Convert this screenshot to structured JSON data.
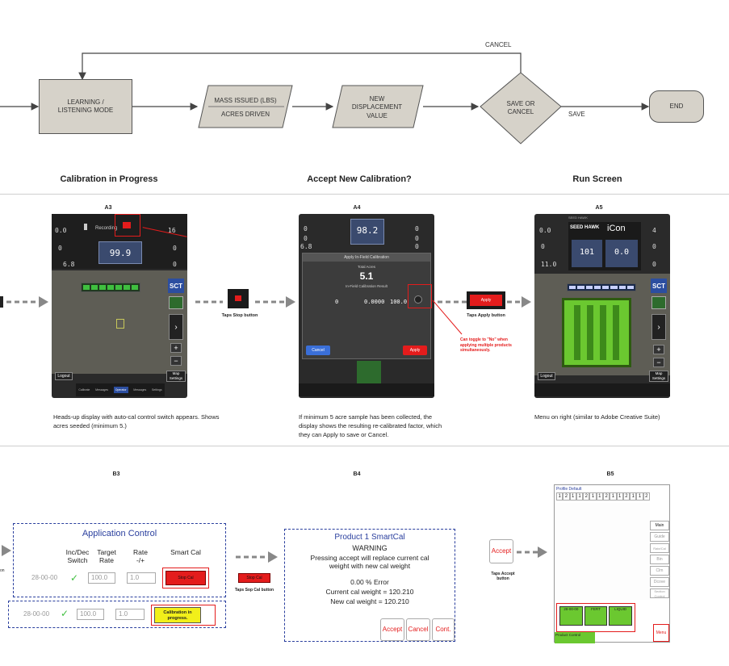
{
  "flow": {
    "cancel_label": "CANCEL",
    "save_label": "SAVE",
    "learning_label": "LEARNING / LISTENING MODE",
    "mass_label": "MASS ISSUED (LBS)",
    "acres_label": "ACRES DRIVEN",
    "new_disp_label": "NEW DISPLACEMENT VALUE",
    "save_cancel_label": "SAVE OR CANCEL",
    "end_label": "END"
  },
  "sections": {
    "calibration": "Calibration in Progress",
    "accept": "Accept New Calibration?",
    "run": "Run Screen"
  },
  "screen_a3": {
    "label": "A3",
    "caption": "Heads-up display with auto-cal control switch appears. Shows acres seeded (minimum 5.)",
    "recording": "Recording",
    "big_value": "99.9",
    "val_left_1": "0.0",
    "val_left_2": "0",
    "val_left_3": "6.8",
    "val_right_1": "16",
    "val_right_2": "0",
    "val_right_3": "0",
    "sct": "SCT",
    "logout": "Logout",
    "map_settings": "Map Settings",
    "nav": [
      "Calibrate",
      "Messages",
      "Operator",
      "Messages",
      "Settings"
    ]
  },
  "arrow_a3_a4": {
    "caption": "Taps Stop button"
  },
  "screen_a4": {
    "label": "A4",
    "caption": "If minimum 5 acre sample has been collected, the display shows the resulting re-calibrated factor, which they can Apply to save or Cancel.",
    "big_value": "98.2",
    "val_left_1": "0",
    "val_left_2": "0",
    "val_left_3": "6.8",
    "val_right_1": "0",
    "val_right_2": "0",
    "val_right_3": "0",
    "dialog_title": "Apply In-Field Calibration",
    "total_acres_label": "Total Acres",
    "total_acres": "5.1",
    "result_label": "In-Field Calibration Result",
    "row_values": [
      "0",
      "0.0000",
      "100.0"
    ],
    "cancel_btn": "Cancel",
    "apply_btn": "Apply",
    "toggle_note": "Can toggle to \"No\" when applying multiple products simultaneously."
  },
  "arrow_a4_a5": {
    "button": "Apply",
    "caption": "Taps Apply button"
  },
  "screen_a5": {
    "label": "A5",
    "caption": "Menu on right (similar to Adobe Creative Suite)",
    "brand": "SEED HAWK",
    "icon_brand": "iCon",
    "val_left_1": "0.0",
    "val_left_2": "0",
    "val_left_3": "11.0",
    "val_right_1": "4",
    "val_right_2": "0",
    "val_right_3": "0",
    "value_1": "101",
    "value_2": "0.0",
    "sct": "SCT",
    "logout": "Logout",
    "map_settings": "Map Settings"
  },
  "screen_b3": {
    "label": "B3",
    "title": "Application Control",
    "col_headers": [
      "Inc/Dec Switch",
      "Target Rate",
      "Rate -/+",
      "Smart Cal"
    ],
    "row1": {
      "product": "28-00-00",
      "target": "100.0",
      "rate": "1.0",
      "button": "Stop Cal"
    },
    "row2": {
      "product": "28-00-00",
      "target": "100.0",
      "rate": "1.0",
      "button": "Calibration in progress."
    },
    "side_text": "on"
  },
  "arrow_b3_b4": {
    "button": "Stop Cal",
    "caption": "Taps Sop Cal button"
  },
  "screen_b4": {
    "label": "B4",
    "title": "Product 1 SmartCal",
    "warning": "WARNING",
    "message": "Pressing accept will replace current cal weight with new cal weight",
    "error": "0.00 % Error",
    "current": "Current cal weight = 120.210",
    "new": "New cal weight = 120.210",
    "buttons": [
      "Accept",
      "Cancel",
      "Cont."
    ]
  },
  "arrow_b4_b5": {
    "button": "Accept",
    "caption": "Taps Accept button"
  },
  "screen_b5": {
    "label": "B5",
    "profile": "Profile Default",
    "sections": [
      "1",
      "2",
      "1",
      "1",
      "2",
      "1",
      "1",
      "2",
      "1",
      "1",
      "2",
      "1",
      "1",
      "2",
      "1",
      "1"
    ],
    "menu_items": [
      "Main",
      "Guide",
      "Rate/Cal",
      "Bin",
      "Clm",
      "Dcove",
      "Section Control"
    ],
    "products": [
      "28-00-00",
      "FERT",
      "LIQUID"
    ],
    "bottom": [
      "Product Control",
      "Menu"
    ]
  },
  "colors": {
    "flow_box": "#d6d2c9",
    "accent_red": "#e41c1c",
    "dialog_blue": "#2a3f9e",
    "screen_dark": "#2a2a2a",
    "active_green": "#3fbf3f"
  }
}
